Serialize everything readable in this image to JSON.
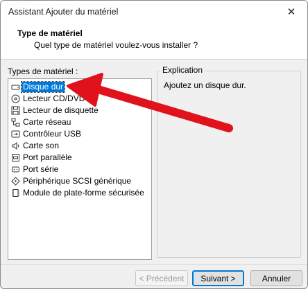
{
  "window": {
    "title": "Assistant Ajouter du matériel",
    "close_label": "✕"
  },
  "header": {
    "title": "Type de matériel",
    "subtitle": "Quel type de matériel voulez-vous installer ?"
  },
  "hardware_list": {
    "label": "Types de matériel :",
    "items": [
      {
        "label": "Disque dur",
        "icon": "hard-disk-icon",
        "selected": true
      },
      {
        "label": "Lecteur CD/DVD",
        "icon": "cd-dvd-icon"
      },
      {
        "label": "Lecteur de disquette",
        "icon": "floppy-icon"
      },
      {
        "label": "Carte réseau",
        "icon": "network-icon"
      },
      {
        "label": "Contrôleur USB",
        "icon": "usb-icon"
      },
      {
        "label": "Carte son",
        "icon": "speaker-icon"
      },
      {
        "label": "Port parallèle",
        "icon": "parallel-port-icon"
      },
      {
        "label": "Port série",
        "icon": "serial-port-icon"
      },
      {
        "label": "Périphérique SCSI générique",
        "icon": "scsi-icon"
      },
      {
        "label": "Module de plate-forme sécurisée",
        "icon": "tpm-chip-icon"
      }
    ]
  },
  "explanation": {
    "caption": "Explication",
    "text": "Ajoutez un disque dur."
  },
  "buttons": {
    "previous": "< Précédent",
    "next": "Suivant >",
    "cancel": "Annuler"
  },
  "colors": {
    "selection": "#0078d7",
    "arrow": "#e0121b"
  }
}
